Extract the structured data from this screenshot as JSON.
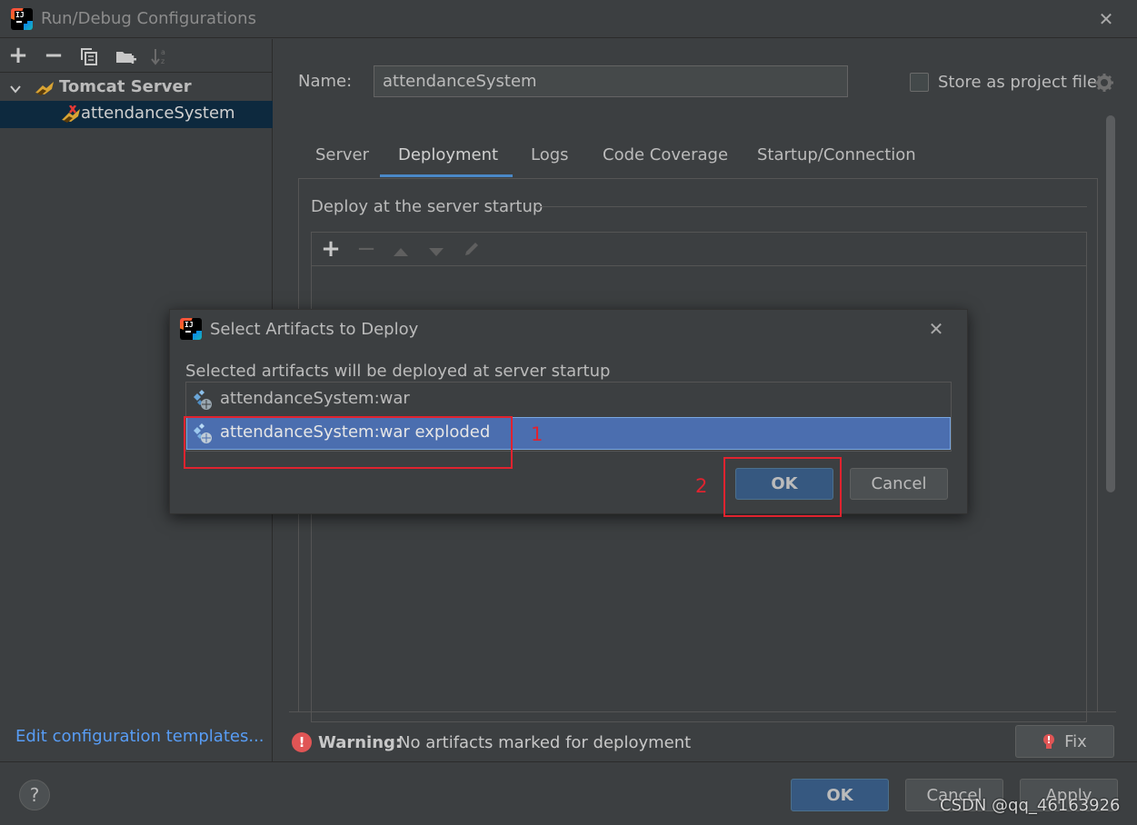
{
  "window": {
    "title": "Run/Debug Configurations",
    "close_glyph": "✕"
  },
  "toolbar": {
    "add_glyph": "+",
    "remove_glyph": "−",
    "sort_glyph": "↓"
  },
  "tree": {
    "group_label": "Tomcat Server",
    "item_label": "attendanceSystem",
    "expand_glyph": "⌄"
  },
  "edit_templates_link": "Edit configuration templates...",
  "help_glyph": "?",
  "form": {
    "name_label": "Name:",
    "name_value": "attendanceSystem",
    "store_label": "Store as project file",
    "store_checked": false
  },
  "tabs": [
    {
      "label": "Server",
      "active": false
    },
    {
      "label": "Deployment",
      "active": true
    },
    {
      "label": "Logs",
      "active": false
    },
    {
      "label": "Code Coverage",
      "active": false
    },
    {
      "label": "Startup/Connection",
      "active": false
    }
  ],
  "deploy": {
    "section_label": "Deploy at the server startup",
    "add_glyph": "+",
    "remove_glyph": "−"
  },
  "warning": {
    "bold": "Warning:",
    "text": "No artifacts marked for deployment",
    "fix_label": "Fix",
    "glyph": "!"
  },
  "footer": {
    "ok_label": "OK",
    "cancel_label": "Cancel",
    "apply_label": "Apply"
  },
  "modal": {
    "title": "Select Artifacts to Deploy",
    "close_glyph": "✕",
    "subtitle": "Selected artifacts will be deployed at server startup",
    "artifacts": [
      {
        "label": "attendanceSystem:war",
        "selected": false
      },
      {
        "label": "attendanceSystem:war exploded",
        "selected": true
      }
    ],
    "ok_label": "OK",
    "cancel_label": "Cancel"
  },
  "annotations": {
    "step1": "1",
    "step2": "2"
  },
  "watermark": "CSDN @qq_46163926",
  "colors": {
    "background": "#3c3f41",
    "selection": "#4b6eaf",
    "accent": "#4a88c7",
    "annotation_red": "#e0232f",
    "link": "#589df6"
  }
}
